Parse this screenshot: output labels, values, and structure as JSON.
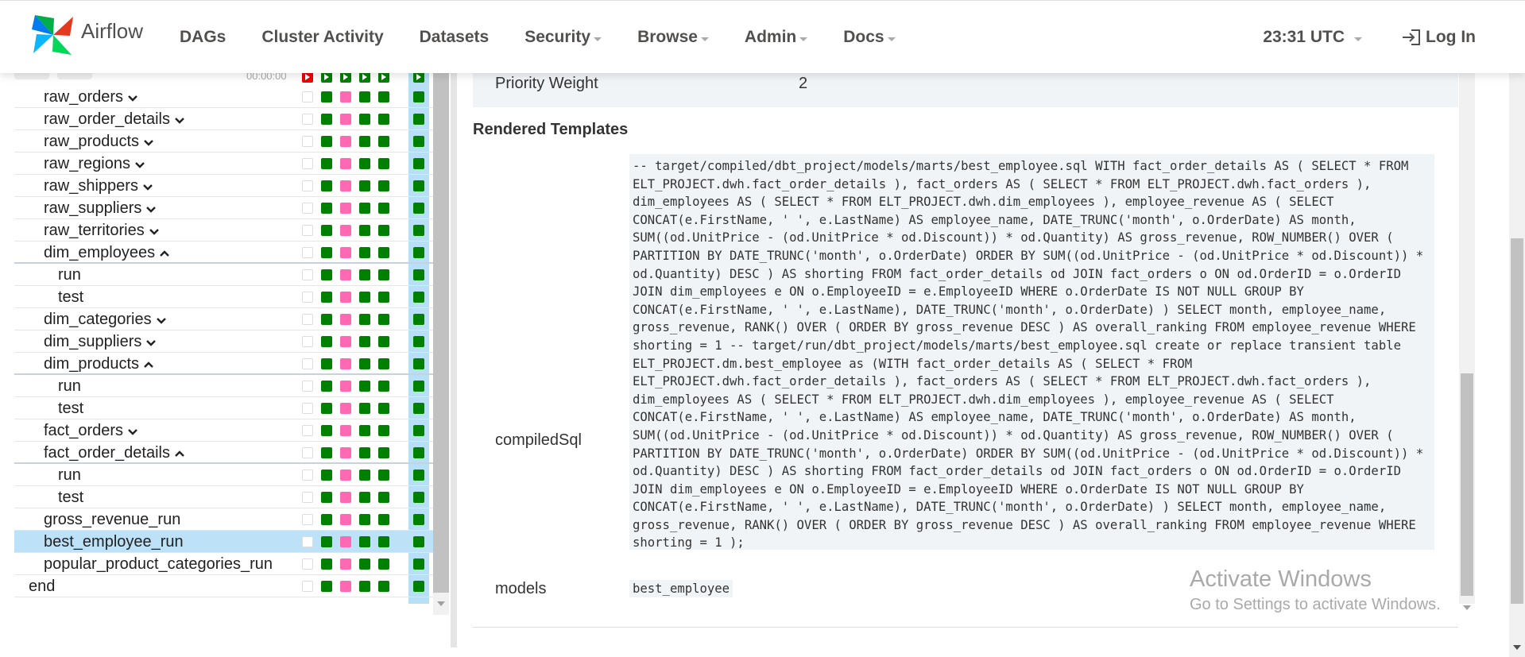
{
  "navbar": {
    "brand": "Airflow",
    "items": [
      {
        "label": "DAGs",
        "dropdown": false
      },
      {
        "label": "Cluster Activity",
        "dropdown": false
      },
      {
        "label": "Datasets",
        "dropdown": false
      },
      {
        "label": "Security",
        "dropdown": true
      },
      {
        "label": "Browse",
        "dropdown": true
      },
      {
        "label": "Admin",
        "dropdown": true
      },
      {
        "label": "Docs",
        "dropdown": true
      }
    ],
    "clock": "23:31 UTC",
    "login": "Log In"
  },
  "tree": {
    "header_time": "00:00:00",
    "rows": [
      {
        "label": "raw_orders",
        "indent": 1,
        "chevron": "down",
        "first": "empty"
      },
      {
        "label": "raw_order_details",
        "indent": 1,
        "chevron": "down",
        "first": "empty"
      },
      {
        "label": "raw_products",
        "indent": 1,
        "chevron": "down",
        "first": "empty"
      },
      {
        "label": "raw_regions",
        "indent": 1,
        "chevron": "down",
        "first": "empty"
      },
      {
        "label": "raw_shippers",
        "indent": 1,
        "chevron": "down",
        "first": "empty"
      },
      {
        "label": "raw_suppliers",
        "indent": 1,
        "chevron": "down",
        "first": "empty"
      },
      {
        "label": "raw_territories",
        "indent": 1,
        "chevron": "down",
        "first": "empty"
      },
      {
        "label": "dim_employees",
        "indent": 1,
        "chevron": "up",
        "first": "empty",
        "thick": true
      },
      {
        "label": "run",
        "indent": 2,
        "chevron": "",
        "first": "empty"
      },
      {
        "label": "test",
        "indent": 2,
        "chevron": "",
        "first": "empty"
      },
      {
        "label": "dim_categories",
        "indent": 1,
        "chevron": "down",
        "first": "empty"
      },
      {
        "label": "dim_suppliers",
        "indent": 1,
        "chevron": "down",
        "first": "empty"
      },
      {
        "label": "dim_products",
        "indent": 1,
        "chevron": "up",
        "first": "empty",
        "thick": true
      },
      {
        "label": "run",
        "indent": 2,
        "chevron": "",
        "first": "empty"
      },
      {
        "label": "test",
        "indent": 2,
        "chevron": "",
        "first": "empty"
      },
      {
        "label": "fact_orders",
        "indent": 1,
        "chevron": "down",
        "first": "empty"
      },
      {
        "label": "fact_order_details",
        "indent": 1,
        "chevron": "up",
        "first": "empty",
        "thick": true
      },
      {
        "label": "run",
        "indent": 2,
        "chevron": "",
        "first": "empty"
      },
      {
        "label": "test",
        "indent": 2,
        "chevron": "",
        "first": "empty"
      },
      {
        "label": "gross_revenue_run",
        "indent": 1,
        "chevron": "",
        "first": "empty"
      },
      {
        "label": "best_employee_run",
        "indent": 1,
        "chevron": "",
        "first": "empty",
        "selected": true
      },
      {
        "label": "popular_product_categories_run",
        "indent": 1,
        "chevron": "",
        "first": "empty"
      },
      {
        "label": "end",
        "indent": 0,
        "chevron": "",
        "first": "empty"
      }
    ],
    "cell_pattern": [
      "green",
      "pink",
      "green",
      "green",
      "green"
    ],
    "colors": {
      "success": "#008000",
      "skipped": "#ff69b4",
      "failed": "#ee0000",
      "selected": "#bde1f6"
    }
  },
  "details": {
    "priority_label": "Priority Weight",
    "priority_value": "2",
    "section_title": "Rendered Templates",
    "compiled_label": "compiledSql",
    "compiled_sql": "-- target/compiled/dbt_project/models/marts/best_employee.sql WITH fact_order_details AS ( SELECT * FROM ELT_PROJECT.dwh.fact_order_details ), fact_orders AS ( SELECT * FROM ELT_PROJECT.dwh.fact_orders ), dim_employees AS ( SELECT * FROM ELT_PROJECT.dwh.dim_employees ), employee_revenue AS ( SELECT CONCAT(e.FirstName, ' ', e.LastName) AS employee_name, DATE_TRUNC('month', o.OrderDate) AS month, SUM((od.UnitPrice - (od.UnitPrice * od.Discount)) * od.Quantity) AS gross_revenue, ROW_NUMBER() OVER ( PARTITION BY DATE_TRUNC('month', o.OrderDate) ORDER BY SUM((od.UnitPrice - (od.UnitPrice * od.Discount)) * od.Quantity) DESC ) AS shorting FROM fact_order_details od JOIN fact_orders o ON od.OrderID = o.OrderID JOIN dim_employees e ON o.EmployeeID = e.EmployeeID WHERE o.OrderDate IS NOT NULL GROUP BY CONCAT(e.FirstName, ' ', e.LastName), DATE_TRUNC('month', o.OrderDate) ) SELECT month, employee_name, gross_revenue, RANK() OVER ( ORDER BY gross_revenue DESC ) AS overall_ranking FROM employee_revenue WHERE shorting = 1 -- target/run/dbt_project/models/marts/best_employee.sql create or replace transient table ELT_PROJECT.dm.best_employee as (WITH fact_order_details AS ( SELECT * FROM ELT_PROJECT.dwh.fact_order_details ), fact_orders AS ( SELECT * FROM ELT_PROJECT.dwh.fact_orders ), dim_employees AS ( SELECT * FROM ELT_PROJECT.dwh.dim_employees ), employee_revenue AS ( SELECT CONCAT(e.FirstName, ' ', e.LastName) AS employee_name, DATE_TRUNC('month', o.OrderDate) AS month, SUM((od.UnitPrice - (od.UnitPrice * od.Discount)) * od.Quantity) AS gross_revenue, ROW_NUMBER() OVER ( PARTITION BY DATE_TRUNC('month', o.OrderDate) ORDER BY SUM((od.UnitPrice - (od.UnitPrice * od.Discount)) * od.Quantity) DESC ) AS shorting FROM fact_order_details od JOIN fact_orders o ON od.OrderID = o.OrderID JOIN dim_employees e ON o.EmployeeID = e.EmployeeID WHERE o.OrderDate IS NOT NULL GROUP BY CONCAT(e.FirstName, ' ', e.LastName), DATE_TRUNC('month', o.OrderDate) ) SELECT month, employee_name, gross_revenue, RANK() OVER ( ORDER BY gross_revenue DESC ) AS overall_ranking FROM employee_revenue WHERE shorting = 1 );",
    "models_label": "models",
    "models_value": "best_employee"
  },
  "watermark": {
    "title": "Activate Windows",
    "subtitle": "Go to Settings to activate Windows."
  }
}
